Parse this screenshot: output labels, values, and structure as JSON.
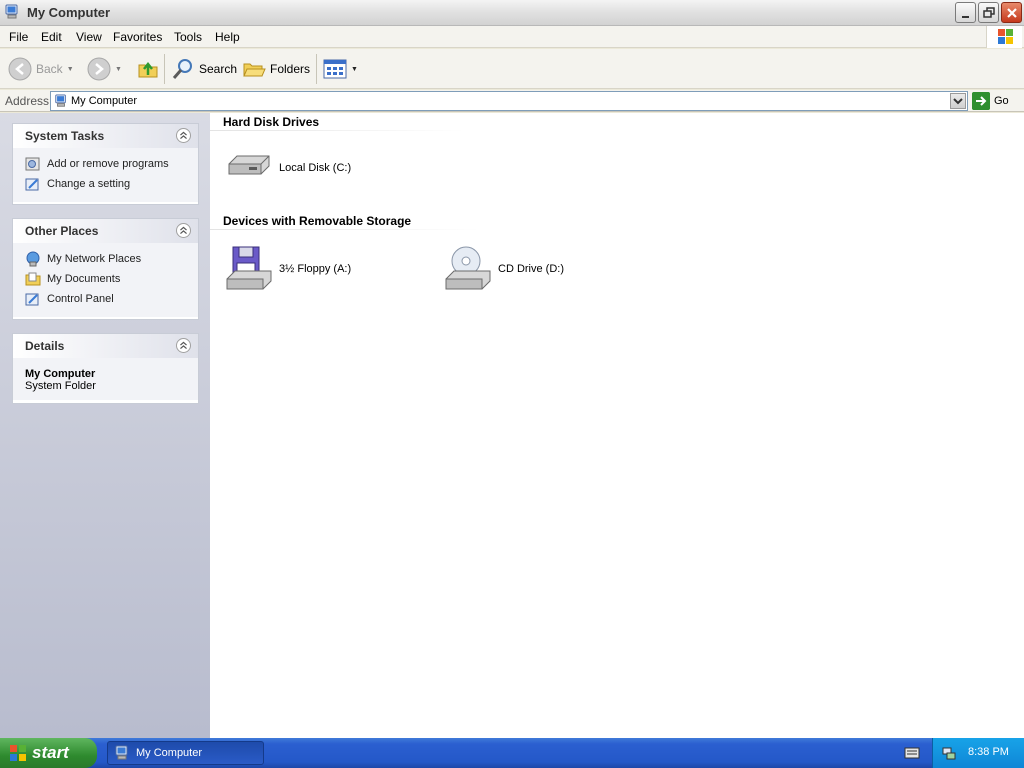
{
  "window": {
    "title": "My Computer"
  },
  "menu": {
    "items": [
      "File",
      "Edit",
      "View",
      "Favorites",
      "Tools",
      "Help"
    ]
  },
  "toolbar": {
    "back_label": "Back",
    "search_label": "Search",
    "folders_label": "Folders"
  },
  "address": {
    "label": "Address",
    "value": "My Computer",
    "go_label": "Go"
  },
  "left_panels": {
    "system_tasks": {
      "title": "System Tasks",
      "items": [
        "Add or remove programs",
        "Change a setting"
      ]
    },
    "other_places": {
      "title": "Other Places",
      "items": [
        "My Network Places",
        "My Documents",
        "Control Panel"
      ]
    },
    "details": {
      "title": "Details",
      "name": "My Computer",
      "type": "System Folder"
    }
  },
  "groups": {
    "hard_disks": {
      "title": "Hard Disk Drives",
      "items": [
        "Local Disk (C:)"
      ]
    },
    "removable": {
      "title": "Devices with Removable Storage",
      "items": [
        "3½ Floppy (A:)",
        "CD Drive (D:)"
      ]
    }
  },
  "taskbar": {
    "start_label": "start",
    "task_label": "My Computer",
    "clock": "8:38 PM"
  },
  "colors": {
    "taskbar_blue": "#2458c8",
    "start_green": "#2e8a2e",
    "tray_blue": "#0f86d6",
    "pane_blue": "#c6c9d8"
  }
}
